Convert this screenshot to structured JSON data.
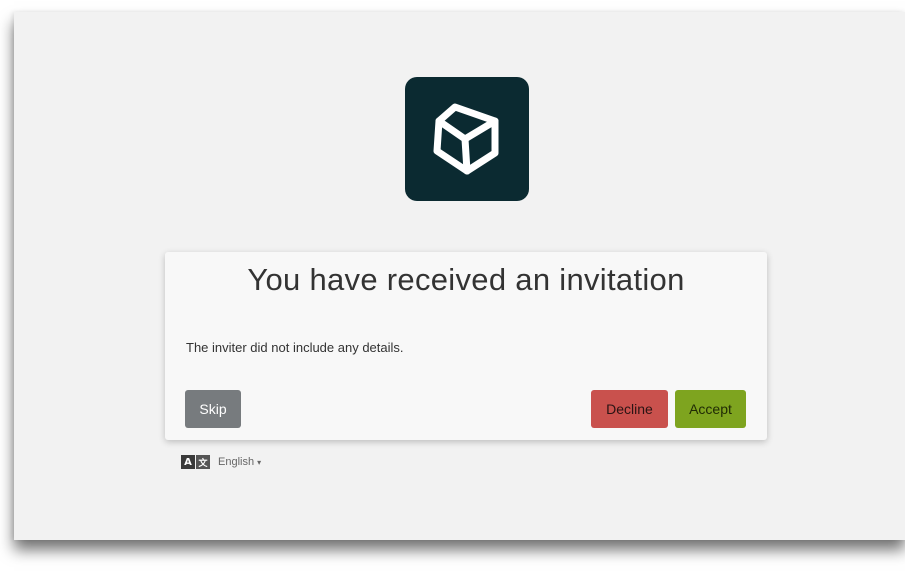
{
  "logo": {
    "icon": "cube-icon",
    "background": "#0b2a31"
  },
  "invitation": {
    "title": "You have received an invitation",
    "message": "The inviter did not include any details."
  },
  "buttons": {
    "skip": "Skip",
    "decline": "Decline",
    "accept": "Accept"
  },
  "language": {
    "icon_a": "A",
    "icon_b": "文",
    "selected": "English",
    "caret": "▾"
  },
  "colors": {
    "skip": "#777b7e",
    "decline": "#c9514d",
    "accept": "#7ea41f"
  }
}
